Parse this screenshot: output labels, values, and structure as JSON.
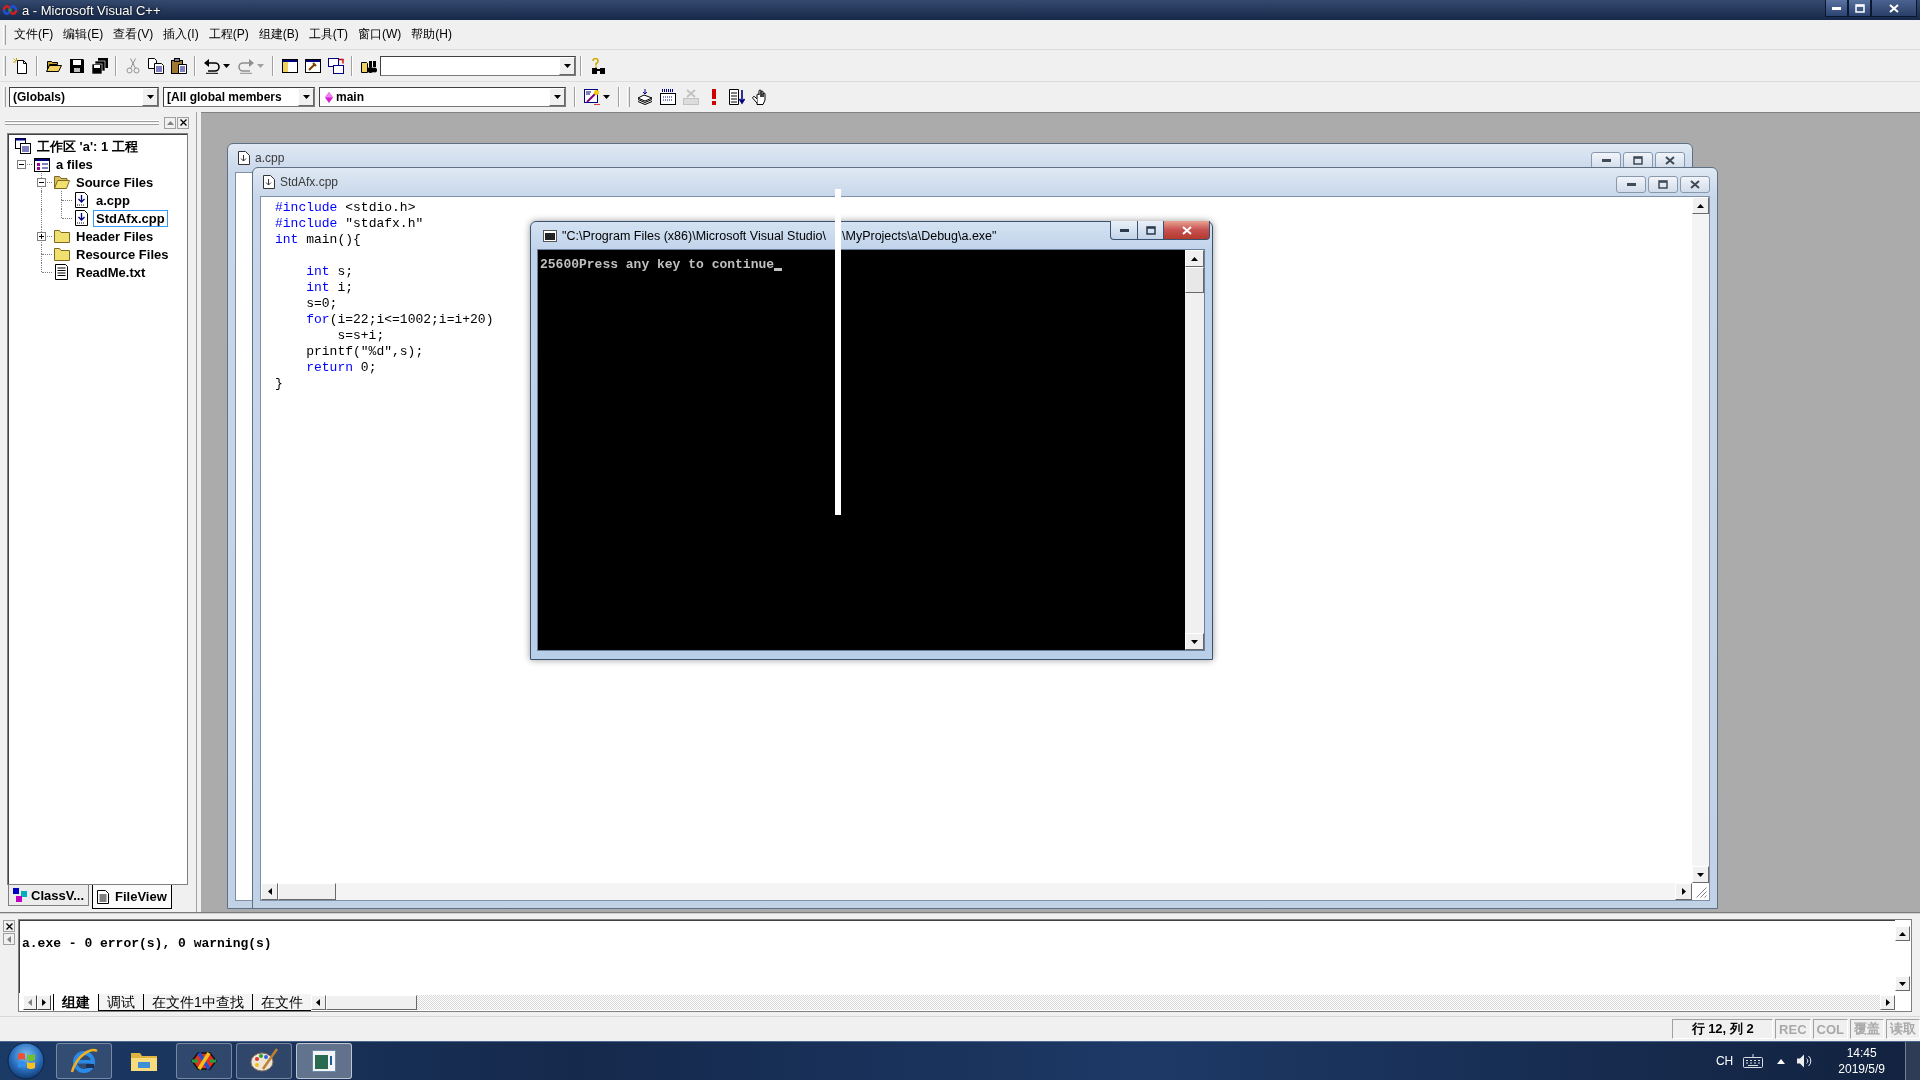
{
  "window": {
    "title": "a - Microsoft Visual C++"
  },
  "menu": [
    "文件(F)",
    "编辑(E)",
    "查看(V)",
    "插入(I)",
    "工程(P)",
    "组建(B)",
    "工具(T)",
    "窗口(W)",
    "帮助(H)"
  ],
  "toolbar_1": {
    "groups": [
      [
        {
          "kind": "new",
          "disabled": false
        }
      ],
      [
        {
          "kind": "open",
          "disabled": false
        },
        {
          "kind": "save",
          "disabled": false
        },
        {
          "kind": "save_all",
          "disabled": false
        }
      ],
      [
        {
          "kind": "cut",
          "disabled": true
        },
        {
          "kind": "copy",
          "disabled": false
        },
        {
          "kind": "paste",
          "disabled": false
        }
      ],
      [
        {
          "kind": "undo",
          "disabled": false
        },
        {
          "kind": "redo",
          "disabled": true
        }
      ],
      [
        {
          "kind": "workspace",
          "disabled": false
        },
        {
          "kind": "output",
          "disabled": false
        },
        {
          "kind": "windows",
          "disabled": false
        }
      ],
      [
        {
          "kind": "find_in_files",
          "disabled": false
        },
        {
          "kind": "find_combo",
          "disabled": false
        }
      ],
      [
        {
          "kind": "find",
          "disabled": false
        }
      ]
    ]
  },
  "toolbar_2": {
    "combos": [
      {
        "value": "(Globals)",
        "kind": "scope"
      },
      {
        "value": "[All global members",
        "kind": "filter"
      },
      {
        "value": "main",
        "kind": "function"
      }
    ],
    "groups": [
      [
        {
          "kind": "wizard",
          "disabled": false
        }
      ],
      [
        {
          "kind": "compile",
          "disabled": false
        },
        {
          "kind": "build",
          "disabled": false
        },
        {
          "kind": "stop_build",
          "disabled": true
        },
        {
          "kind": "execute",
          "disabled": false
        },
        {
          "kind": "go",
          "disabled": false
        },
        {
          "kind": "breakpoint",
          "disabled": false
        }
      ]
    ]
  },
  "workspace": {
    "tree": [
      {
        "label": "工作区 'a': 1 工程",
        "kind": "workspace",
        "selected": false,
        "children": [
          {
            "label": "a files",
            "kind": "project",
            "expanded": true,
            "selected": false,
            "children": [
              {
                "label": "Source Files",
                "kind": "folder",
                "expanded": true,
                "selected": false,
                "children": [
                  {
                    "label": "a.cpp",
                    "kind": "source",
                    "selected": false
                  },
                  {
                    "label": "StdAfx.cpp",
                    "kind": "source",
                    "selected": true
                  }
                ]
              },
              {
                "label": "Header Files",
                "kind": "folder",
                "expanded": false,
                "selected": false
              },
              {
                "label": "Resource Files",
                "kind": "folder",
                "selected": false
              },
              {
                "label": "ReadMe.txt",
                "kind": "text",
                "selected": false
              }
            ]
          }
        ]
      }
    ],
    "tabs": [
      {
        "label": "ClassV...",
        "kind": "class",
        "selected": false
      },
      {
        "label": "FileView",
        "kind": "file",
        "selected": true
      }
    ]
  },
  "editors": [
    {
      "title": "a.cpp"
    },
    {
      "title": "StdAfx.cpp",
      "code": [
        {
          "text": "#include",
          "kind": "keyword"
        },
        {
          "text": " <stdio.h>\n",
          "kind": "plain"
        },
        {
          "text": "#include",
          "kind": "keyword"
        },
        {
          "text": " \"stdafx.h\"\n",
          "kind": "plain"
        },
        {
          "text": "int",
          "kind": "keyword"
        },
        {
          "text": " main(){\n\n    ",
          "kind": "plain"
        },
        {
          "text": "int",
          "kind": "keyword"
        },
        {
          "text": " s;\n    ",
          "kind": "plain"
        },
        {
          "text": "int",
          "kind": "keyword"
        },
        {
          "text": " i;\n    s=0;\n    ",
          "kind": "plain"
        },
        {
          "text": "for",
          "kind": "keyword"
        },
        {
          "text": "(i=22;i<=1002;i=i+20)\n        s=s+i;\n    printf(\"%d\",s);\n    ",
          "kind": "plain"
        },
        {
          "text": "return",
          "kind": "keyword"
        },
        {
          "text": " 0;\n}",
          "kind": "plain"
        }
      ]
    }
  ],
  "console": {
    "title_parts": [
      "\"C:\\Program Files (x86)\\Microsoft Visual Studio\\",
      "\\MyProjects\\a\\Debug\\a.exe\""
    ],
    "output": "25600Press any key to continue"
  },
  "output": {
    "text": "a.exe - 0 error(s), 0 warning(s)",
    "tabs": [
      {
        "label": "组建",
        "selected": true
      },
      {
        "label": "调试",
        "selected": false
      },
      {
        "label": "在文件1中查找",
        "selected": false
      },
      {
        "label": "在文件",
        "selected": false
      }
    ]
  },
  "status_bar": {
    "panes": [
      {
        "text": "行 12, 列 2",
        "disabled": false
      },
      {
        "text": "REC",
        "disabled": true
      },
      {
        "text": "COL",
        "disabled": true
      },
      {
        "text": "覆盖",
        "disabled": true
      },
      {
        "text": "读取",
        "disabled": true
      }
    ]
  },
  "taskbar": {
    "apps": [
      {
        "kind": "browser",
        "running": true,
        "selected": false
      },
      {
        "kind": "folder",
        "running": false,
        "selected": false
      },
      {
        "kind": "ide",
        "running": true,
        "selected": false
      },
      {
        "kind": "paint",
        "running": true,
        "selected": false
      },
      {
        "kind": "console",
        "running": true,
        "selected": true
      }
    ],
    "language": "CH",
    "time": "14:45",
    "date": "2019/5/9"
  }
}
